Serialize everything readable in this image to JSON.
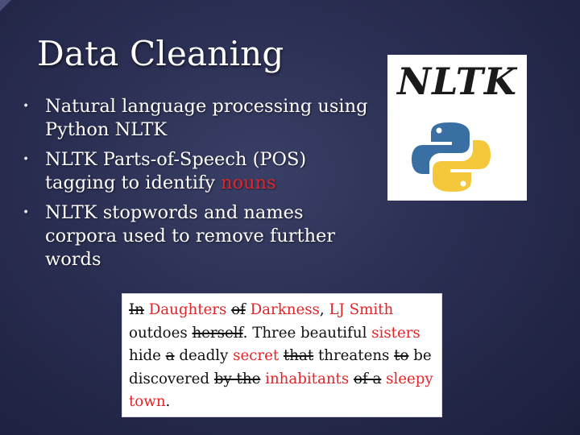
{
  "slide": {
    "title": "Data Cleaning",
    "bullets": [
      {
        "parts": [
          {
            "text": "Natural language processing using Python NLTK",
            "highlight": false
          }
        ]
      },
      {
        "parts": [
          {
            "text": "NLTK Parts-of-Speech (POS) tagging to identify ",
            "highlight": false
          },
          {
            "text": "nouns",
            "highlight": true
          }
        ]
      },
      {
        "parts": [
          {
            "text": "NLTK stopwords and names corpora used to remove further words",
            "highlight": false
          }
        ]
      }
    ],
    "bullet_symbol": "•"
  },
  "logo": {
    "text": "NLTK",
    "icon": "python-logo"
  },
  "excerpt": {
    "tokens": [
      {
        "text": "In",
        "style": "struck"
      },
      {
        "text": " ",
        "style": "plain"
      },
      {
        "text": "Daughters",
        "style": "noun"
      },
      {
        "text": " ",
        "style": "plain"
      },
      {
        "text": "of",
        "style": "struck"
      },
      {
        "text": " ",
        "style": "plain"
      },
      {
        "text": "Darkness",
        "style": "noun"
      },
      {
        "text": ", ",
        "style": "plain"
      },
      {
        "text": "LJ Smith",
        "style": "noun"
      },
      {
        "text": " outdoes ",
        "style": "plain"
      },
      {
        "text": "herself",
        "style": "struck"
      },
      {
        "text": ". Three beautiful ",
        "style": "plain"
      },
      {
        "text": "sisters",
        "style": "noun"
      },
      {
        "text": " hide ",
        "style": "plain"
      },
      {
        "text": "a",
        "style": "struck"
      },
      {
        "text": " deadly ",
        "style": "plain"
      },
      {
        "text": "secret",
        "style": "noun"
      },
      {
        "text": " ",
        "style": "plain"
      },
      {
        "text": "that",
        "style": "struck"
      },
      {
        "text": " threatens ",
        "style": "plain"
      },
      {
        "text": "to",
        "style": "struck"
      },
      {
        "text": " be discovered ",
        "style": "plain"
      },
      {
        "text": "by the",
        "style": "struck"
      },
      {
        "text": " ",
        "style": "plain"
      },
      {
        "text": "inhabitants",
        "style": "noun"
      },
      {
        "text": " ",
        "style": "plain"
      },
      {
        "text": "of a",
        "style": "struck"
      },
      {
        "text": " ",
        "style": "plain"
      },
      {
        "text": "sleepy town",
        "style": "noun"
      },
      {
        "text": ".",
        "style": "plain"
      }
    ]
  },
  "colors": {
    "background": "#2a2e52",
    "highlight_red": "#e0262a",
    "python_blue": "#3a6fa3",
    "python_yellow": "#f5c73a"
  }
}
